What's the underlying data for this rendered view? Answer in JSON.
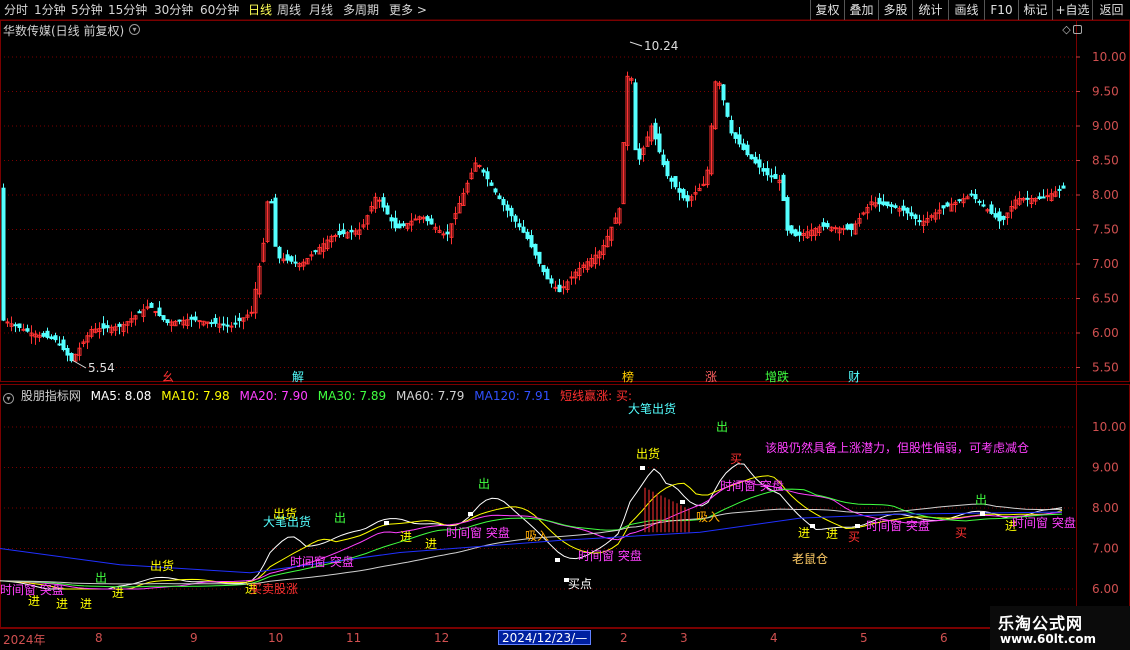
{
  "toolbar": {
    "periods": [
      "分时",
      "1分钟",
      "5分钟",
      "15分钟",
      "30分钟",
      "60分钟",
      "日线",
      "周线",
      "月线",
      "多周期",
      "更多 >"
    ],
    "active_period": "日线",
    "buttons": [
      "复权",
      "叠加",
      "多股",
      "统计",
      "画线",
      "F10",
      "标记",
      "+自选",
      "返回"
    ]
  },
  "main_panel": {
    "title": "华数传媒(日线 前复权)",
    "price_ticks": [
      "10.00",
      "9.50",
      "9.00",
      "8.50",
      "8.00",
      "7.50",
      "7.00",
      "6.50",
      "6.00",
      "5.50"
    ],
    "high_label": "10.24",
    "low_label": "5.54",
    "event_markers": [
      "幺",
      "解",
      "榜",
      "涨",
      "增跌",
      "财"
    ]
  },
  "indicator_panel": {
    "name": "股朋指标网",
    "ma": [
      {
        "label": "MA5: 8.08",
        "color": "#ffffff"
      },
      {
        "label": "MA10: 7.98",
        "color": "#ffff00"
      },
      {
        "label": "MA20: 7.90",
        "color": "#ff40ff"
      },
      {
        "label": "MA30: 7.89",
        "color": "#40ff40"
      },
      {
        "label": "MA60: 7.79",
        "color": "#d0d0d0"
      },
      {
        "label": "MA120: 7.91",
        "color": "#4060ff"
      }
    ],
    "signal_text": "短线赢涨: 买:",
    "price_ticks": [
      "10.00",
      "9.00",
      "8.00",
      "7.00",
      "6.00"
    ],
    "advice": "该股仍然具备上涨潜力，但股性偏弱，可考虑减仓",
    "labels": {
      "dabi_chuhuo": "大笔出货",
      "chu": "出",
      "chuhuo": "出货",
      "jin": "进",
      "mai": "买",
      "xishou": "吸入",
      "maidian": "买点",
      "shijian_tupan": "时间窗 突盘",
      "laoshucang": "老鼠仓",
      "maimai_zhang": "买卖股涨"
    }
  },
  "date_axis": {
    "labels": [
      "2024年",
      "8",
      "9",
      "10",
      "11",
      "12",
      "1",
      "2",
      "3",
      "4",
      "5",
      "6"
    ],
    "cursor_date": "2024/12/23/—"
  },
  "watermark": {
    "title": "乐淘公式网",
    "url": "www.60lt.com"
  },
  "colors": {
    "up": "#ff3232",
    "down": "#54ffff",
    "grid": "#7a0000",
    "axis_text": "#d05050",
    "ma5": "#ffffff",
    "ma10": "#ffff00",
    "ma20": "#ff40ff",
    "ma30": "#40ff40",
    "ma60": "#d0d0d0",
    "ma120": "#2030ff"
  }
}
